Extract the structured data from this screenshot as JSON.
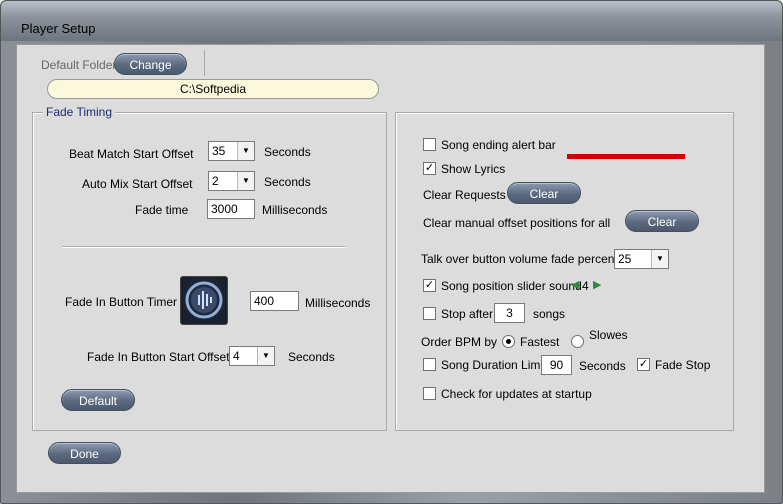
{
  "window": {
    "title": "Player Setup"
  },
  "folder": {
    "label": "Default Folder",
    "change_label": "Change",
    "path": "C:\\Softpedia"
  },
  "fade_timing": {
    "legend": "Fade Timing",
    "beat_match_label": "Beat Match Start Offset",
    "beat_match_value": "35",
    "beat_match_unit": "Seconds",
    "auto_mix_label": "Auto Mix Start Offset",
    "auto_mix_value": "2",
    "auto_mix_unit": "Seconds",
    "fade_time_label": "Fade time",
    "fade_time_value": "3000",
    "fade_time_unit": "Milliseconds",
    "fade_in_timer_label": "Fade In Button Timer",
    "fade_in_timer_value": "400",
    "fade_in_timer_unit": "Milliseconds",
    "fade_in_offset_label": "Fade In Button Start Offset",
    "fade_in_offset_value": "4",
    "fade_in_offset_unit": "Seconds",
    "default_label": "Default"
  },
  "options": {
    "song_ending_label": "Song ending alert bar",
    "song_ending_checked": false,
    "alert_color": "#d40000",
    "show_lyrics_label": "Show Lyrics",
    "show_lyrics_checked": true,
    "clear_requests_label": "Clear Requests",
    "clear_requests_button": "Clear",
    "clear_manual_label": "Clear manual offset positions for all",
    "clear_manual_button": "Clear",
    "talk_over_label": "Talk over button volume fade percent",
    "talk_over_value": "25",
    "song_position_label": "Song position slider sound",
    "song_position_checked": true,
    "song_position_value": "4",
    "stop_after_label": "Stop after",
    "stop_after_checked": false,
    "stop_after_value": "3",
    "stop_after_unit": "songs",
    "order_bpm_label": "Order BPM by",
    "fastest_label": "Fastest",
    "slowest_label": "Slowes",
    "song_duration_label": "Song Duration Limit",
    "song_duration_checked": false,
    "song_duration_value": "90",
    "song_duration_unit": "Seconds",
    "fade_stop_label": "Fade Stop",
    "fade_stop_checked": true,
    "check_updates_label": "Check for updates at startup",
    "check_updates_checked": false
  },
  "footer": {
    "done_label": "Done"
  }
}
